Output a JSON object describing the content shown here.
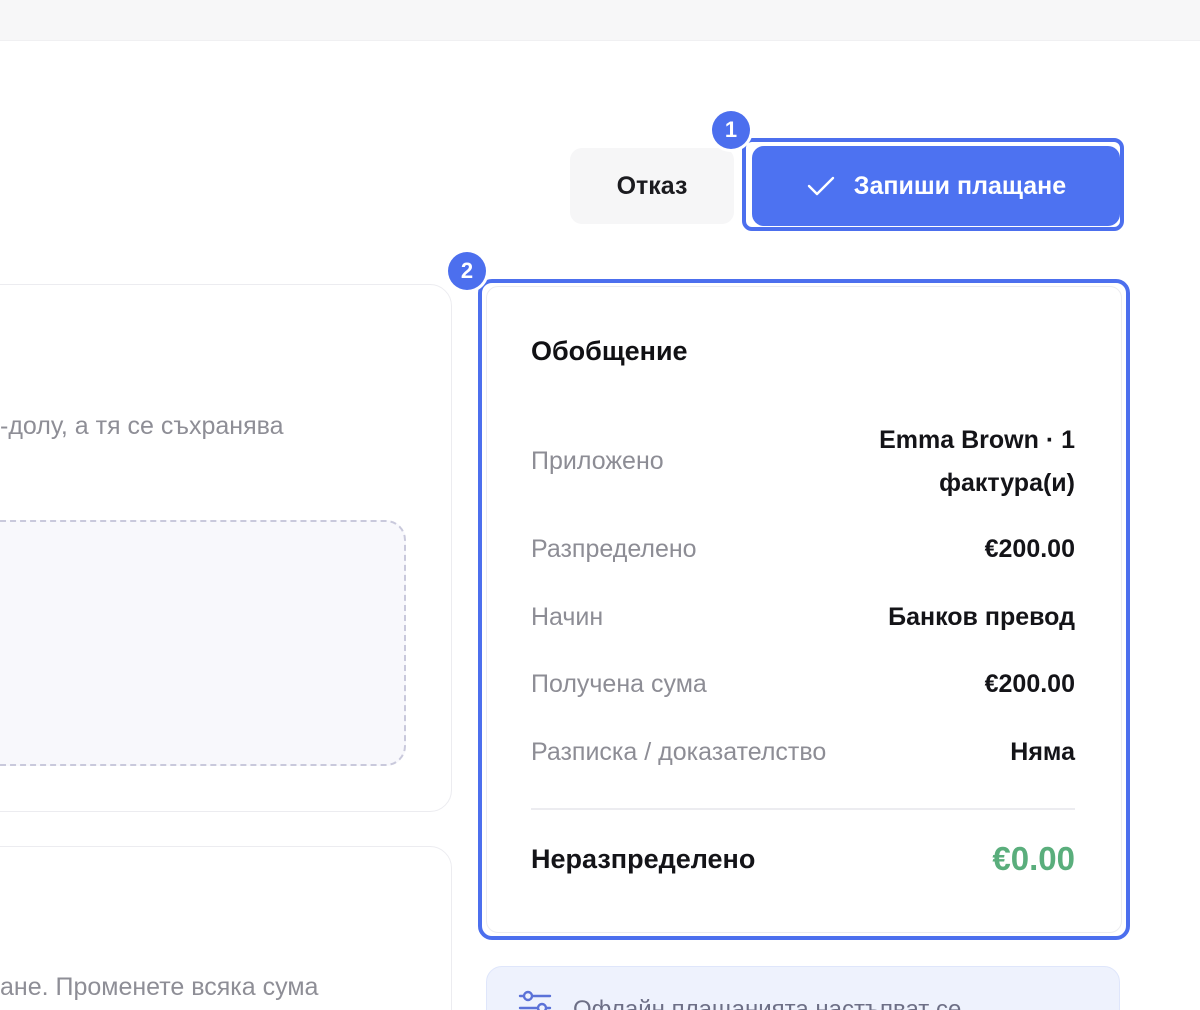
{
  "actions": {
    "cancel_label": "Отказ",
    "save_label": "Запиши плащане"
  },
  "annotations": {
    "badge_1": "1",
    "badge_2": "2"
  },
  "left_panel": {
    "description_fragment": "-долу, а тя се съхранява",
    "allocation_fragment": "ане. Променете всяка сума"
  },
  "summary": {
    "title": "Обобщение",
    "rows": [
      {
        "label": "Приложено",
        "value": "Emma Brown · 1 фактура(и)"
      },
      {
        "label": "Разпределено",
        "value": "€200.00"
      },
      {
        "label": "Начин",
        "value": "Банков превод"
      },
      {
        "label": "Получена сума",
        "value": "€200.00"
      },
      {
        "label": "Разписка / доказателство",
        "value": "Няма"
      }
    ],
    "total_label": "Неразпределено",
    "total_value": "€0.00"
  },
  "info": {
    "text": "Офлайн плащанията настъпват се"
  },
  "colors": {
    "accent": "#4d72f1",
    "highlight": "#4c6fee",
    "positive": "#5aae7c"
  }
}
